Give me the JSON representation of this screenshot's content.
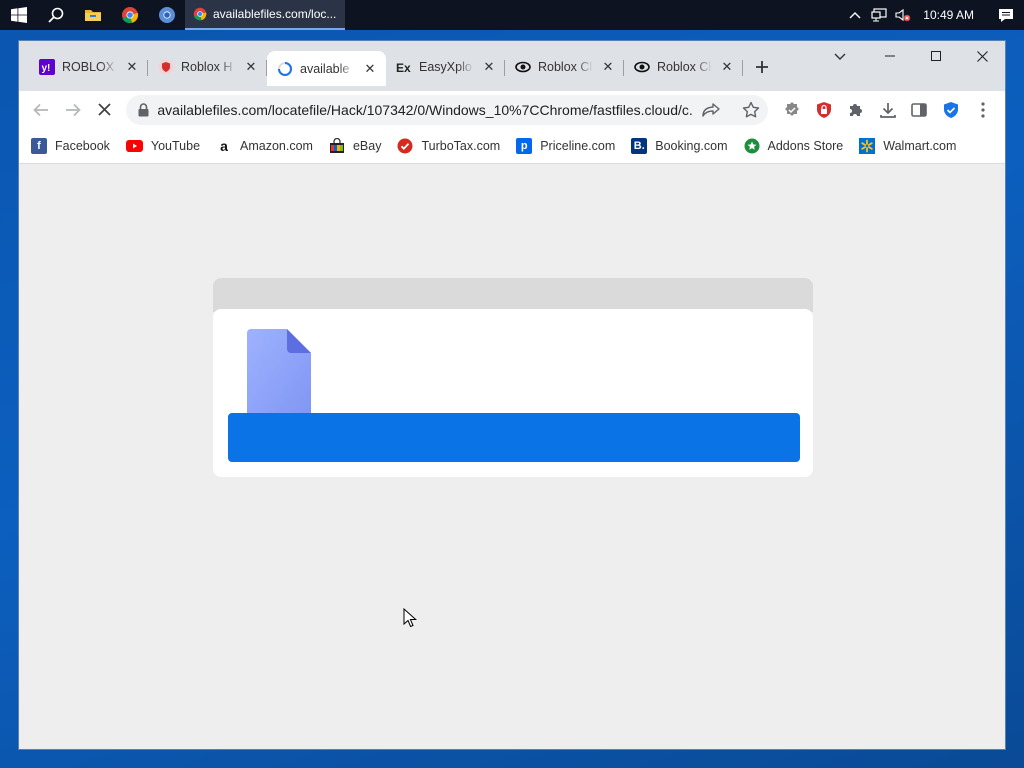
{
  "taskbar": {
    "active_title": "availablefiles.com/loc...",
    "clock": "10:49 AM"
  },
  "browser": {
    "tabs": [
      {
        "label": "ROBLOX C",
        "icon": "yahoo-icon"
      },
      {
        "label": "Roblox H",
        "icon": "shield-icon"
      },
      {
        "label": "available",
        "icon": "loading-icon",
        "active": true
      },
      {
        "label": "EasyXplo",
        "icon": "ex-icon"
      },
      {
        "label": "Roblox Cl",
        "icon": "eye-icon"
      },
      {
        "label": "Roblox Cl",
        "icon": "eye-icon"
      }
    ],
    "url": "availablefiles.com/locatefile/Hack/107342/0/Windows_10%7CChrome/fastfiles.cloud/c...",
    "bookmarks": [
      {
        "label": "Facebook",
        "icon": "facebook-icon",
        "color": "#3b5998"
      },
      {
        "label": "YouTube",
        "icon": "youtube-icon",
        "color": "#ff0000"
      },
      {
        "label": "Amazon.com",
        "icon": "amazon-icon",
        "color": "#111111"
      },
      {
        "label": "eBay",
        "icon": "ebay-icon",
        "color": "#333333"
      },
      {
        "label": "TurboTax.com",
        "icon": "turbotax-icon",
        "color": "#d52b1e"
      },
      {
        "label": "Priceline.com",
        "icon": "priceline-icon",
        "color": "#0068ef"
      },
      {
        "label": "Booking.com",
        "icon": "booking-icon",
        "color": "#003580"
      },
      {
        "label": "Addons Store",
        "icon": "addons-icon",
        "color": "#1e8e3e"
      },
      {
        "label": "Walmart.com",
        "icon": "walmart-icon",
        "color": "#0071ce"
      }
    ]
  },
  "page": {
    "accent": "#0a73e6",
    "header_color": "#dadada",
    "background": "#eeeeee"
  }
}
